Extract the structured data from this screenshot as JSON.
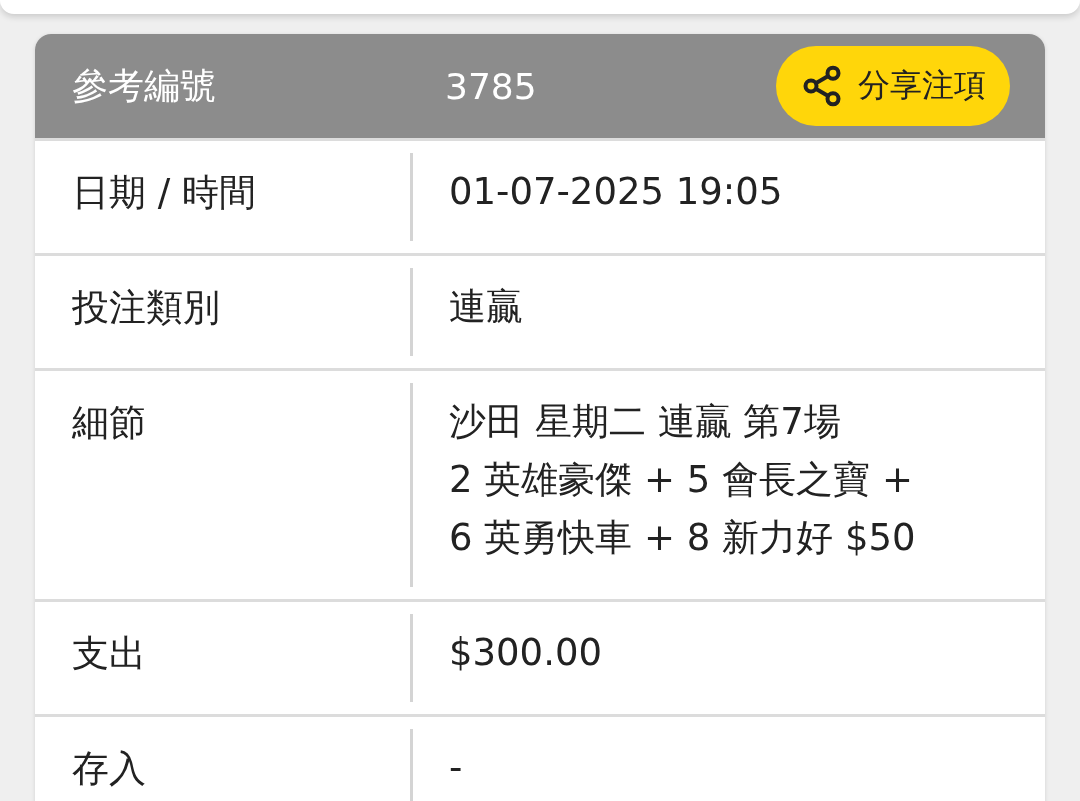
{
  "header": {
    "label": "參考編號",
    "value": "3785",
    "share_button": "分享注項"
  },
  "rows": [
    {
      "label": "日期 / 時間",
      "lines": [
        "01-07-2025 19:05"
      ]
    },
    {
      "label": "投注類別",
      "lines": [
        "連贏"
      ]
    },
    {
      "label": "細節",
      "lines": [
        "沙田 星期二 連贏 第7場",
        "2 英雄豪傑 + 5 會長之寶 +",
        "6 英勇快車 + 8 新力好 $50"
      ]
    },
    {
      "label": "支出",
      "lines": [
        "$300.00"
      ]
    },
    {
      "label": "存入",
      "lines": [
        "-"
      ]
    }
  ]
}
